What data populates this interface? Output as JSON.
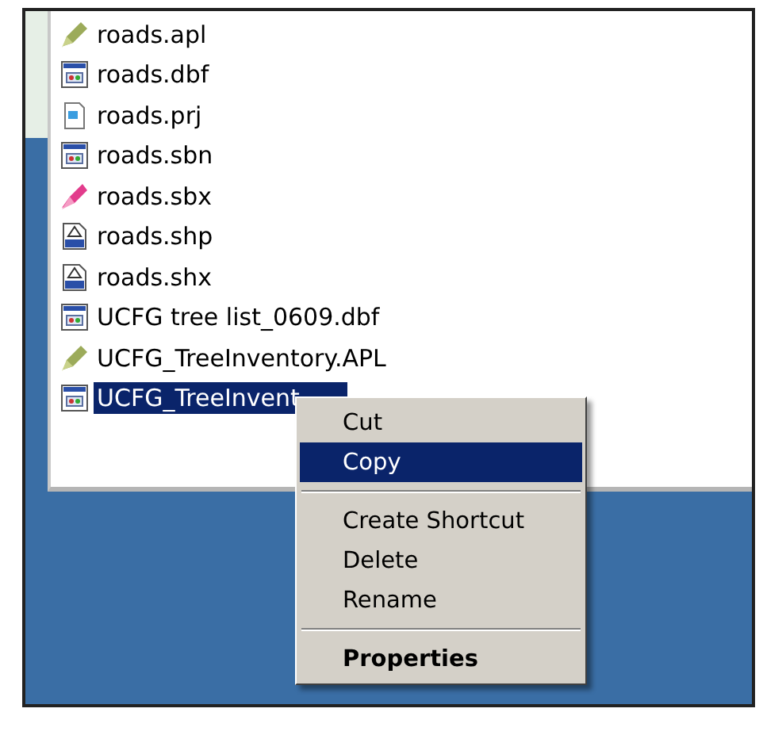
{
  "files": [
    {
      "name": "roads.apl",
      "kind": "apl",
      "selected": false
    },
    {
      "name": "roads.dbf",
      "kind": "dbf",
      "selected": false
    },
    {
      "name": "roads.prj",
      "kind": "prj",
      "selected": false
    },
    {
      "name": "roads.sbn",
      "kind": "dbf",
      "selected": false
    },
    {
      "name": "roads.sbx",
      "kind": "sbx",
      "selected": false
    },
    {
      "name": "roads.shp",
      "kind": "shp",
      "selected": false
    },
    {
      "name": "roads.shx",
      "kind": "shp",
      "selected": false
    },
    {
      "name": "UCFG tree list_0609.dbf",
      "kind": "dbf",
      "selected": false
    },
    {
      "name": "UCFG_TreeInventory.APL",
      "kind": "apl",
      "selected": false
    },
    {
      "name": "UCFG_TreeInvent",
      "kind": "dbf",
      "selected": true
    }
  ],
  "context_menu": [
    {
      "kind": "item",
      "label": "Cut",
      "selected": false
    },
    {
      "kind": "item",
      "label": "Copy",
      "selected": true
    },
    {
      "kind": "separator"
    },
    {
      "kind": "item",
      "label": "Create Shortcut",
      "selected": false
    },
    {
      "kind": "item",
      "label": "Delete",
      "selected": false
    },
    {
      "kind": "item",
      "label": "Rename",
      "selected": false
    },
    {
      "kind": "separator"
    },
    {
      "kind": "default",
      "label": "Properties",
      "selected": false
    }
  ]
}
